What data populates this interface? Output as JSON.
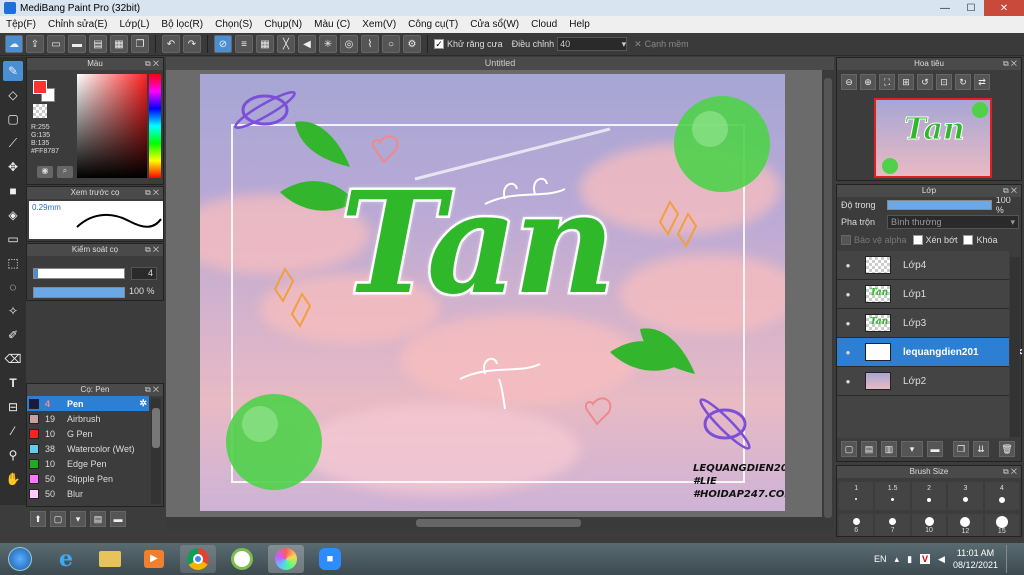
{
  "window": {
    "title": "MediBang Paint Pro (32bit)"
  },
  "menu": [
    "Tệp(F)",
    "Chỉnh sửa(E)",
    "Lớp(L)",
    "Bộ lọc(R)",
    "Chọn(S)",
    "Chụp(N)",
    "Màu (C)",
    "Xem(V)",
    "Công cụ(T)",
    "Cửa sổ(W)",
    "Cloud",
    "Help"
  ],
  "toolbar": {
    "antialias_label": "Khử răng cưa",
    "adjust_label": "Điều chỉnh",
    "adjust_value": "40",
    "edge_label": "Cạnh mềm"
  },
  "color_panel": {
    "title": "Màu",
    "r": "R:255",
    "g": "G:135",
    "b": "B:135",
    "hex": "#FF8787",
    "primary_color": "#ff3333",
    "secondary_color": "#ffffff"
  },
  "brush_preview": {
    "title": "Xem trước cọ",
    "size": "0.29mm"
  },
  "brush_control": {
    "title": "Kiểm soát cọ",
    "size_value": "4",
    "opacity_value": "100 %"
  },
  "brush_list": {
    "title": "Cọ: Pen",
    "items": [
      {
        "size": "4",
        "name": "Pen",
        "color": "#1a1a3a"
      },
      {
        "size": "19",
        "name": "Airbrush",
        "color": "#c8a0a0"
      },
      {
        "size": "10",
        "name": "G Pen",
        "color": "#ff2020"
      },
      {
        "size": "38",
        "name": "Watercolor (Wet)",
        "color": "#66ccee"
      },
      {
        "size": "10",
        "name": "Edge Pen",
        "color": "#22aa22"
      },
      {
        "size": "50",
        "name": "Stipple Pen",
        "color": "#ff77ff"
      },
      {
        "size": "50",
        "name": "Blur",
        "color": "#ffccff"
      }
    ]
  },
  "document": {
    "tab": "Untitled",
    "title_art": "Tan",
    "credit_lines": [
      "LEQUANGDIEN201",
      "#LIE",
      "#HOIDAP247.COM"
    ]
  },
  "navigator": {
    "title": "Hoa tiêu",
    "art_text": "Tan"
  },
  "layers_panel": {
    "title": "Lớp",
    "opacity_label": "Độ trong",
    "opacity_value": "100 %",
    "blend_label": "Pha trộn",
    "blend_value": "Bình thường",
    "protect_alpha": "Bảo vệ alpha",
    "clip": "Xén bớt",
    "lock": "Khóa",
    "layers": [
      "Lớp4",
      "Lớp1",
      "Lớp3",
      "lequangdien201",
      "Lớp2"
    ],
    "thumbnail_art_text": "Tan",
    "selected_index": 3
  },
  "brush_size": {
    "title": "Brush Size",
    "row1": [
      "1",
      "1.5",
      "2",
      "3",
      "4"
    ],
    "row2": [
      "6",
      "7",
      "10",
      "12",
      "15"
    ]
  },
  "taskbar": {
    "lang": "EN",
    "time": "11:01 AM",
    "date": "08/12/2021"
  }
}
